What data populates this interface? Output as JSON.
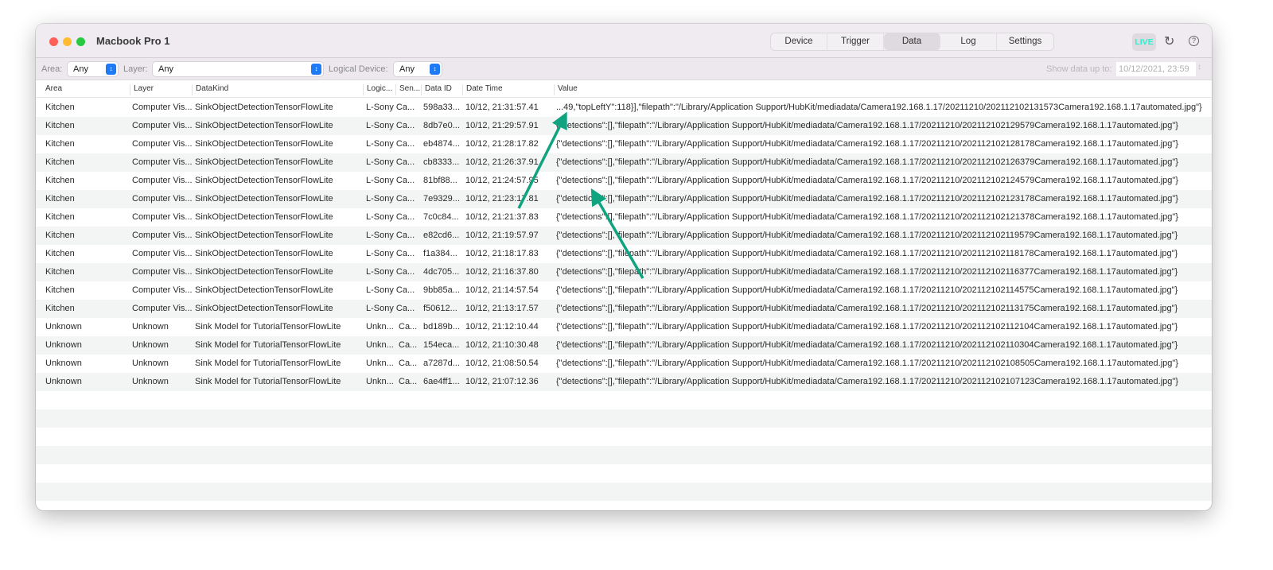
{
  "window": {
    "title": "Macbook Pro 1"
  },
  "tabs": [
    {
      "label": "Device"
    },
    {
      "label": "Trigger"
    },
    {
      "label": "Data",
      "active": true
    },
    {
      "label": "Log"
    },
    {
      "label": "Settings"
    }
  ],
  "toolbar": {
    "live_label": "LIVE",
    "live_color": "#2ef0d0",
    "refresh_icon": "refresh-icon",
    "help_icon": "help-icon"
  },
  "filters": {
    "area_label": "Area:",
    "area_value": "Any",
    "layer_label": "Layer:",
    "layer_value": "Any",
    "device_label": "Logical Device:",
    "device_value": "Any",
    "show_label": "Show data up to:",
    "show_value": "10/12/2021, 23:59"
  },
  "columns": [
    "Area",
    "Layer",
    "DataKind",
    "Logic...",
    "Sen...",
    "Data ID",
    "Date Time",
    "Value"
  ],
  "rows": [
    [
      "Kitchen",
      "Computer Vis...",
      "SinkObjectDetectionTensorFlowLite",
      "L-Sony Ca...",
      "",
      "598a33...",
      "10/12, 21:31:57.41",
      "...49,\"topLeftY\":118}],\"filepath\":\"/Library/Application Support/HubKit/mediadata/Camera192.168.1.17/20211210/202112102131573Camera192.168.1.17automated.jpg\"}"
    ],
    [
      "Kitchen",
      "Computer Vis...",
      "SinkObjectDetectionTensorFlowLite",
      "L-Sony Ca...",
      "",
      "8db7e0...",
      "10/12, 21:29:57.91",
      "{\"detections\":[],\"filepath\":\"/Library/Application Support/HubKit/mediadata/Camera192.168.1.17/20211210/202112102129579Camera192.168.1.17automated.jpg\"}"
    ],
    [
      "Kitchen",
      "Computer Vis...",
      "SinkObjectDetectionTensorFlowLite",
      "L-Sony Ca...",
      "",
      "eb4874...",
      "10/12, 21:28:17.82",
      "{\"detections\":[],\"filepath\":\"/Library/Application Support/HubKit/mediadata/Camera192.168.1.17/20211210/202112102128178Camera192.168.1.17automated.jpg\"}"
    ],
    [
      "Kitchen",
      "Computer Vis...",
      "SinkObjectDetectionTensorFlowLite",
      "L-Sony Ca...",
      "",
      "cb8333...",
      "10/12, 21:26:37.91",
      "{\"detections\":[],\"filepath\":\"/Library/Application Support/HubKit/mediadata/Camera192.168.1.17/20211210/202112102126379Camera192.168.1.17automated.jpg\"}"
    ],
    [
      "Kitchen",
      "Computer Vis...",
      "SinkObjectDetectionTensorFlowLite",
      "L-Sony Ca...",
      "",
      "81bf88...",
      "10/12, 21:24:57.95",
      "{\"detections\":[],\"filepath\":\"/Library/Application Support/HubKit/mediadata/Camera192.168.1.17/20211210/202112102124579Camera192.168.1.17automated.jpg\"}"
    ],
    [
      "Kitchen",
      "Computer Vis...",
      "SinkObjectDetectionTensorFlowLite",
      "L-Sony Ca...",
      "",
      "7e9329...",
      "10/12, 21:23:17.81",
      "{\"detections\":[],\"filepath\":\"/Library/Application Support/HubKit/mediadata/Camera192.168.1.17/20211210/202112102123178Camera192.168.1.17automated.jpg\"}"
    ],
    [
      "Kitchen",
      "Computer Vis...",
      "SinkObjectDetectionTensorFlowLite",
      "L-Sony Ca...",
      "",
      "7c0c84...",
      "10/12, 21:21:37.83",
      "{\"detections\":[],\"filepath\":\"/Library/Application Support/HubKit/mediadata/Camera192.168.1.17/20211210/202112102121378Camera192.168.1.17automated.jpg\"}"
    ],
    [
      "Kitchen",
      "Computer Vis...",
      "SinkObjectDetectionTensorFlowLite",
      "L-Sony Ca...",
      "",
      "e82cd6...",
      "10/12, 21:19:57.97",
      "{\"detections\":[],\"filepath\":\"/Library/Application Support/HubKit/mediadata/Camera192.168.1.17/20211210/202112102119579Camera192.168.1.17automated.jpg\"}"
    ],
    [
      "Kitchen",
      "Computer Vis...",
      "SinkObjectDetectionTensorFlowLite",
      "L-Sony Ca...",
      "",
      "f1a384...",
      "10/12, 21:18:17.83",
      "{\"detections\":[],\"filepath\":\"/Library/Application Support/HubKit/mediadata/Camera192.168.1.17/20211210/202112102118178Camera192.168.1.17automated.jpg\"}"
    ],
    [
      "Kitchen",
      "Computer Vis...",
      "SinkObjectDetectionTensorFlowLite",
      "L-Sony Ca...",
      "",
      "4dc705...",
      "10/12, 21:16:37.80",
      "{\"detections\":[],\"filepath\":\"/Library/Application Support/HubKit/mediadata/Camera192.168.1.17/20211210/202112102116377Camera192.168.1.17automated.jpg\"}"
    ],
    [
      "Kitchen",
      "Computer Vis...",
      "SinkObjectDetectionTensorFlowLite",
      "L-Sony Ca...",
      "",
      "9bb85a...",
      "10/12, 21:14:57.54",
      "{\"detections\":[],\"filepath\":\"/Library/Application Support/HubKit/mediadata/Camera192.168.1.17/20211210/202112102114575Camera192.168.1.17automated.jpg\"}"
    ],
    [
      "Kitchen",
      "Computer Vis...",
      "SinkObjectDetectionTensorFlowLite",
      "L-Sony Ca...",
      "",
      "f50612...",
      "10/12, 21:13:17.57",
      "{\"detections\":[],\"filepath\":\"/Library/Application Support/HubKit/mediadata/Camera192.168.1.17/20211210/202112102113175Camera192.168.1.17automated.jpg\"}"
    ],
    [
      "Unknown",
      "Unknown",
      "Sink Model for TutorialTensorFlowLite",
      "Unkn...",
      "Ca...",
      "bd189b...",
      "10/12, 21:12:10.44",
      "{\"detections\":[],\"filepath\":\"/Library/Application Support/HubKit/mediadata/Camera192.168.1.17/20211210/202112102112104Camera192.168.1.17automated.jpg\"}"
    ],
    [
      "Unknown",
      "Unknown",
      "Sink Model for TutorialTensorFlowLite",
      "Unkn...",
      "Ca...",
      "154eca...",
      "10/12, 21:10:30.48",
      "{\"detections\":[],\"filepath\":\"/Library/Application Support/HubKit/mediadata/Camera192.168.1.17/20211210/202112102110304Camera192.168.1.17automated.jpg\"}"
    ],
    [
      "Unknown",
      "Unknown",
      "Sink Model for TutorialTensorFlowLite",
      "Unkn...",
      "Ca...",
      "a7287d...",
      "10/12, 21:08:50.54",
      "{\"detections\":[],\"filepath\":\"/Library/Application Support/HubKit/mediadata/Camera192.168.1.17/20211210/202112102108505Camera192.168.1.17automated.jpg\"}"
    ],
    [
      "Unknown",
      "Unknown",
      "Sink Model for TutorialTensorFlowLite",
      "Unkn...",
      "Ca...",
      "6ae4ff1...",
      "10/12, 21:07:12.36",
      "{\"detections\":[],\"filepath\":\"/Library/Application Support/HubKit/mediadata/Camera192.168.1.17/20211210/202112102107123Camera192.168.1.17automated.jpg\"}"
    ]
  ],
  "annotation": {
    "arrow_color": "#0fa37f"
  }
}
